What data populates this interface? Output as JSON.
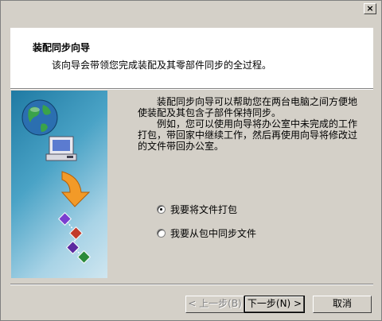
{
  "dialog": {
    "close_symbol": "×",
    "header": {
      "title": "装配同步向导",
      "subtitle": "该向导会带领您完成装配及其零部件同步的全过程。"
    },
    "intro": {
      "para1": "装配同步向导可以帮助您在两台电脑之间方便地使装配及其包含子部件保持同步。",
      "para2": "例如，您可以使用向导将办公室中未完成的工作打包，带回家中继续工作，然后再使用向导将修改过的文件带回办公室。"
    },
    "options": [
      {
        "label": "我要将文件打包",
        "selected": true
      },
      {
        "label": "我要从包中同步文件",
        "selected": false
      }
    ],
    "buttons": {
      "back": "< 上一步(B)",
      "next": "下一步(N) >",
      "cancel": "取消"
    },
    "icons": [
      "globe-icon",
      "computer-icon",
      "arrow-down-icon",
      "sync-nodes-icon"
    ]
  }
}
